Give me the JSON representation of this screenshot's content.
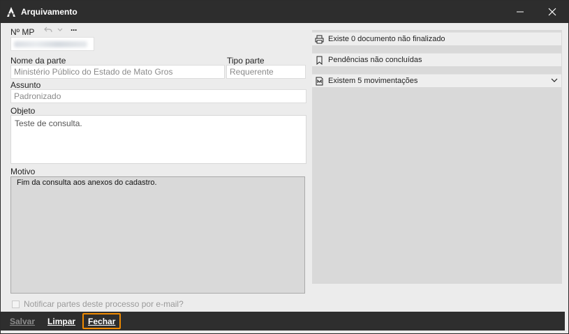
{
  "window": {
    "title": "Arquivamento",
    "app_icon": "app-logo-icon",
    "minimize_icon": "minimize-icon",
    "close_icon": "close-icon"
  },
  "form": {
    "nmp_label": "Nº MP",
    "undo_icon": "undo-icon",
    "dropdown_icon": "chevron-down-icon",
    "more_label": "···",
    "nome_parte_label": "Nome da parte",
    "nome_parte_value": "Ministério Público do Estado de Mato Gros",
    "tipo_parte_label": "Tipo parte",
    "tipo_parte_value": "Requerente",
    "assunto_label": "Assunto",
    "assunto_value": "Padronizado",
    "objeto_label": "Objeto",
    "objeto_value": "Teste de consulta.",
    "motivo_label": "Motivo",
    "motivo_value": "Fim da consulta aos anexos do cadastro.",
    "notify_label": "Notificar partes deste processo por e-mail?"
  },
  "right_panel": {
    "items": [
      {
        "icon": "printer-icon",
        "label": "Existe 0 documento não finalizado"
      },
      {
        "icon": "bookmark-icon",
        "label": "Pendências não concluídas"
      },
      {
        "icon": "document-m-icon",
        "label": "Existem 5 movimentações"
      }
    ]
  },
  "footer": {
    "salvar": "Salvar",
    "limpar": "Limpar",
    "fechar": "Fechar",
    "accent": "#f08a00"
  }
}
